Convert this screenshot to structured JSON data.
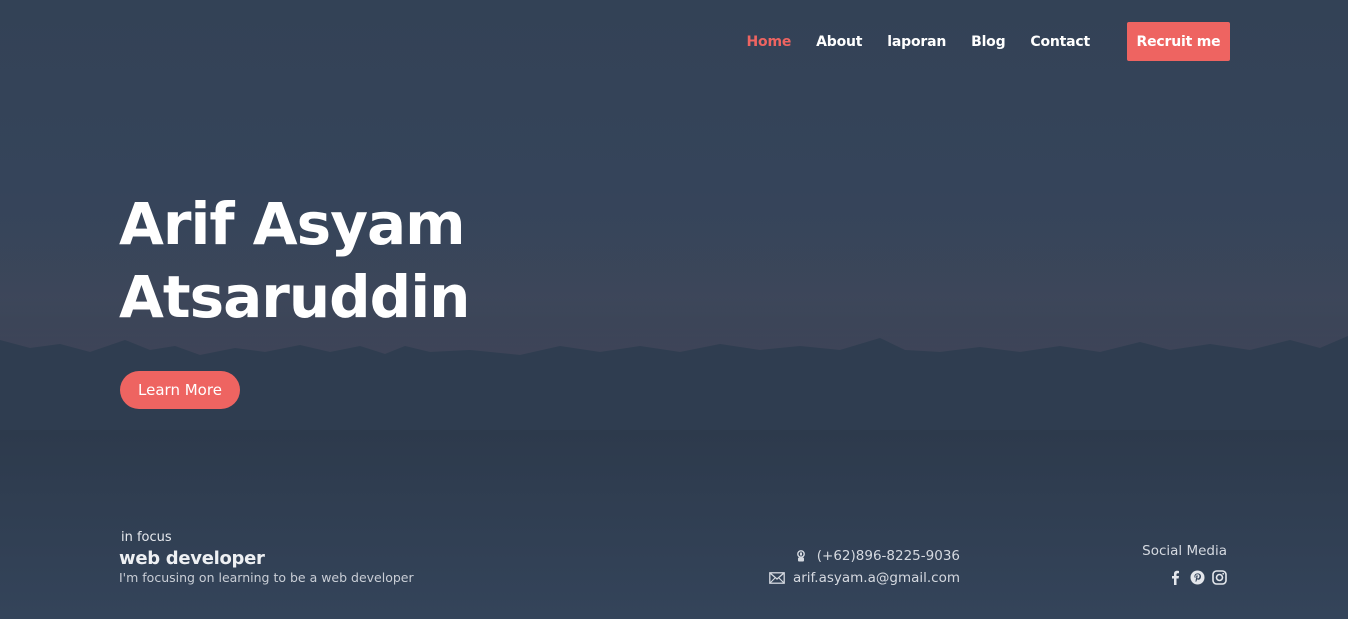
{
  "nav": {
    "items": [
      {
        "label": "Home",
        "active": true
      },
      {
        "label": "About",
        "active": false
      },
      {
        "label": "laporan",
        "active": false
      },
      {
        "label": "Blog",
        "active": false
      },
      {
        "label": "Contact",
        "active": false
      }
    ],
    "cta_label": "Recruit me"
  },
  "hero": {
    "title_line1": "Arif Asyam",
    "title_line2": "Atsaruddin",
    "button_label": "Learn More"
  },
  "focus": {
    "label": "in focus",
    "role": "web developer",
    "description": "I'm focusing on learning to be a web developer"
  },
  "contact": {
    "phone": "(+62)896-8225-9036",
    "email": "arif.asyam.a@gmail.com",
    "phone_icon": "phone-icon",
    "email_icon": "envelope-icon"
  },
  "social": {
    "title": "Social Media",
    "icons": [
      "facebook-icon",
      "pinterest-icon",
      "instagram-icon"
    ]
  },
  "colors": {
    "accent": "#ee6461",
    "background": "#334256",
    "text": "#ffffff"
  }
}
